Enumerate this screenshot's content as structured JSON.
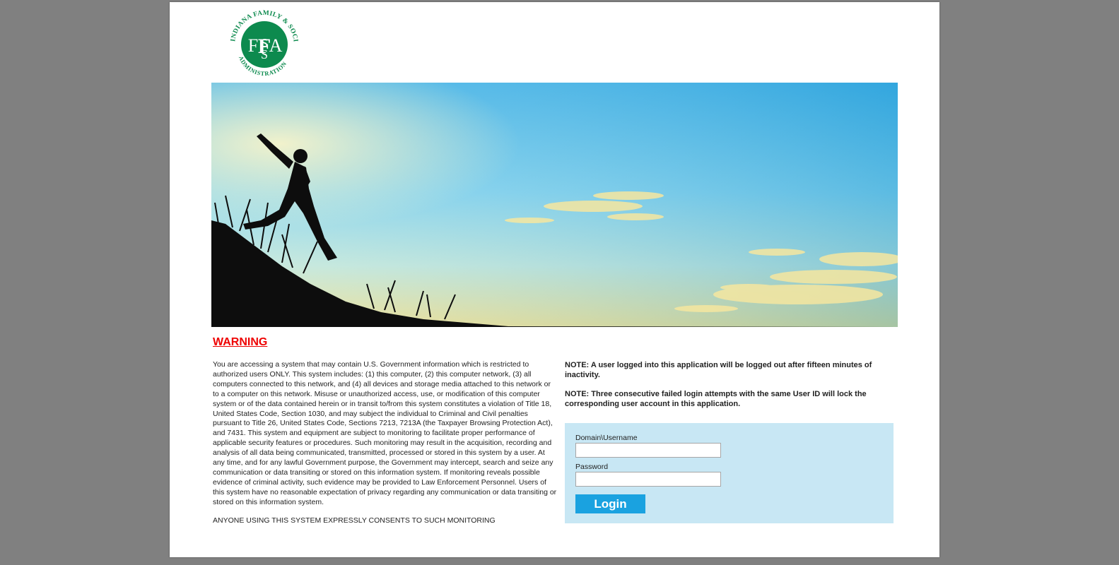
{
  "colors": {
    "background": "#808080",
    "page": "#ffffff",
    "warning_title": "#ee0000",
    "login_panel": "#c8e7f4",
    "login_button": "#1aa2e0",
    "logo_green": "#0d8a4e"
  },
  "header": {
    "logo": {
      "icon": "fssa-seal-logo",
      "text_arc": "INDIANA FAMILY & SOCIAL SERVICES ADMINISTRATION",
      "monogram": "FSSA"
    }
  },
  "hero": {
    "icon": "jumping-girl-sunset-photo"
  },
  "warning": {
    "title": "WARNING",
    "body": "You are accessing a system that may contain U.S. Government information which is restricted to authorized users ONLY. This system includes: (1) this computer, (2) this computer network, (3) all computers connected to this network, and (4) all devices and storage media attached to this network or to a computer on this network. Misuse or unauthorized access, use, or modification of this computer system or of the data contained herein or in transit to/from this system constitutes a violation of Title 18, United States Code, Section 1030, and may subject the individual to Criminal and Civil penalties pursuant to Title 26, United States Code, Sections 7213, 7213A (the Taxpayer Browsing Protection Act), and 7431. This system and equipment are subject to monitoring to facilitate proper performance of applicable security features or procedures. Such monitoring may result in the acquisition, recording and analysis of all data being communicated, transmitted, processed or stored in this system by a user. At any time, and for any lawful Government purpose, the Government may intercept, search and seize any communication or data transiting or stored on this information system. If monitoring reveals possible evidence of criminal activity, such evidence may be provided to Law Enforcement Personnel. Users of this system have no reasonable expectation of privacy regarding any communication or data transiting or stored on this information system.",
    "consent": "ANYONE USING THIS SYSTEM EXPRESSLY CONSENTS TO SUCH MONITORING"
  },
  "notes": [
    {
      "text": "NOTE: A user logged into this application will be logged out after fifteen minutes of inactivity."
    },
    {
      "text": "NOTE: Three consecutive failed login attempts with the same User ID will lock the corresponding user account in this application."
    }
  ],
  "login": {
    "username_label": "Domain\\Username",
    "username_value": "",
    "password_label": "Password",
    "password_value": "",
    "button_label": "Login"
  }
}
